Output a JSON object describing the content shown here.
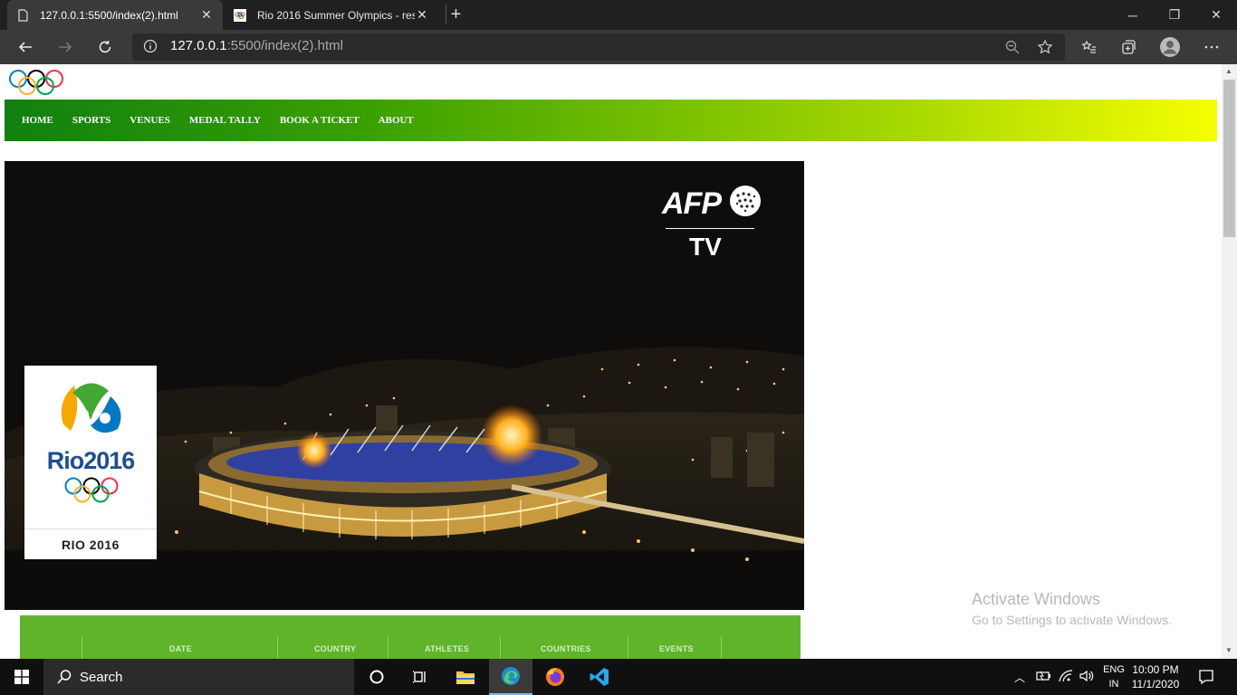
{
  "browser": {
    "tabs": [
      {
        "title": "127.0.0.1:5500/index(2).html",
        "active": true
      },
      {
        "title": "Rio 2016 Summer Olympics - res",
        "active": false
      }
    ],
    "url_host": "127.0.0.1",
    "url_rest": ":5500/index(2).html"
  },
  "nav": {
    "items": [
      "HOME",
      "SPORTS",
      "VENUES",
      "MEDAL TALLY",
      "BOOK A TICKET",
      "ABOUT"
    ]
  },
  "hero": {
    "afp_logo": "AFP",
    "afp_tv": "TV",
    "logo_caption": "RIO 2016",
    "logo_word": "Rio2016"
  },
  "tally": {
    "headers": [
      "DATE",
      "COUNTRY",
      "ATHLETES",
      "COUNTRIES",
      "EVENTS"
    ]
  },
  "watermark": {
    "line1": "Activate Windows",
    "line2": "Go to Settings to activate Windows."
  },
  "taskbar": {
    "search_placeholder": "Search",
    "lang1": "ENG",
    "lang2": "IN",
    "time": "10:00 PM",
    "date": "11/1/2020"
  },
  "colors": {
    "nav_start": "#108010",
    "nav_end": "#f6ff00",
    "tally_bar": "#5fb42a"
  }
}
